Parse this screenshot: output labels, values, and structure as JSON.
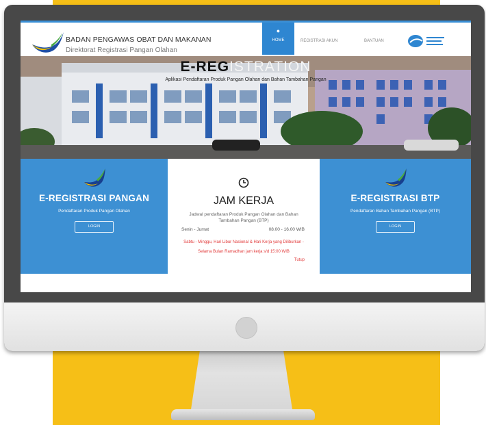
{
  "header": {
    "org_name": "BADAN PENGAWAS OBAT DAN MAKANAN",
    "org_sub": "Direktorat Registrasi Pangan Olahan",
    "nav": {
      "home": "HOME",
      "registrasi_akun": "REGISTRASI AKUN",
      "bantuan": "BANTUAN"
    }
  },
  "hero": {
    "title_bold": "E-REG",
    "title_thin": "ISTRATION",
    "subtitle": "Aplikasi Pendaftaran Produk Pangan Olahan dan Bahan Tambahan Pangan"
  },
  "panel_left": {
    "title": "E-REGISTRASI PANGAN",
    "desc": "Pendaftaran Produk Pangan Olahan",
    "login": "LOGIN"
  },
  "panel_mid": {
    "title": "JAM KERJA",
    "desc": "Jadwal pendaftaran Produk Pangan Olahan dan Bahan Tambahan Pangan (BTP)",
    "days": "Senin - Jumat",
    "hours": "08.00 - 16.00 WIB",
    "note": "Sabtu - Minggu, Hari Libur Nasional & Hari Kerja yang Diliburkan -",
    "ramadan": "Selama Bulan Ramadhan jam kerja s/d 15:00 WIB",
    "closed": "Tutup"
  },
  "panel_right": {
    "title": "E-REGISTRASI BTP",
    "desc": "Pendaftaran Bahan Tambahan Pangan (BTP)",
    "login": "LOGIN"
  },
  "colors": {
    "background_yellow": "#f6bf17",
    "monitor_frame": "#484848",
    "accent_blue": "#3d90d3",
    "note_red": "#e23b3b"
  },
  "icons": {
    "logo": "bpom-swoosh-logo",
    "clock": "clock-icon",
    "ministry": "ministry-logo"
  }
}
